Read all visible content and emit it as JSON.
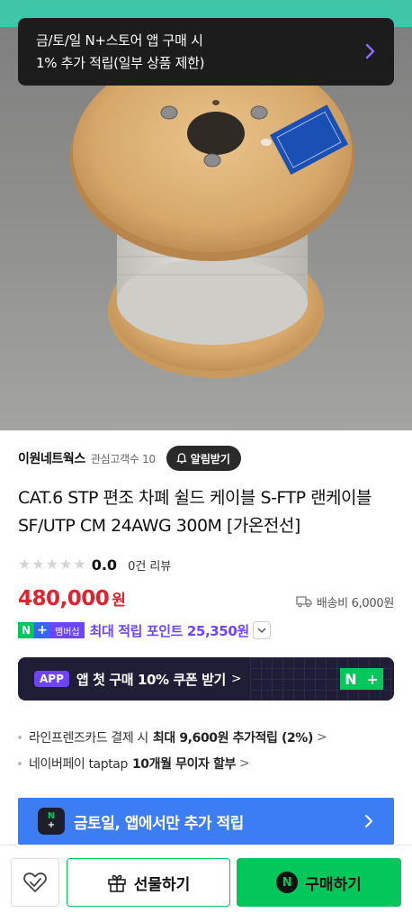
{
  "toast": {
    "line1": "금/토/일 N+스토어 앱 구매 시",
    "line2": "1% 추가 적립(일부 상품 제한)"
  },
  "seller": {
    "name": "이원네트웍스",
    "fans": "관심고객수 10",
    "alarm_label": "알림받기"
  },
  "product": {
    "title": "CAT.6 STP 편조 차폐 쉴드 케이블 S-FTP 랜케이블 SF/UTP CM 24AWG 300M [가온전선]",
    "score": "0.0",
    "reviews": "0건 리뷰",
    "rating_stars": 0
  },
  "price": {
    "amount": "480,000",
    "unit": "원",
    "shipping": "배송비 6,000원"
  },
  "points": {
    "badge_n": "N",
    "badge_plus": "+",
    "badge_label": "멤버십",
    "text": "최대 적립 포인트 25,350원"
  },
  "app_banner": {
    "tag": "APP",
    "text": "앱 첫 구매 10% 쿠폰 받기",
    "chevron": ">",
    "logo_n": "N",
    "logo_plus": "+"
  },
  "benefits": [
    {
      "prefix": "라인프렌즈카드 결제 시",
      "bold": "최대 9,600원 추가적립 (2%)",
      "more": ">"
    },
    {
      "prefix": "네이버페이 taptap",
      "bold": "10개월 무이자 할부",
      "more": ">"
    }
  ],
  "promo": {
    "logo_n": "N",
    "logo_plus": "+",
    "text": "금토일, 앱에서만 추가 적립"
  },
  "bottom_bar": {
    "gift_label": "선물하기",
    "buy_label": "구매하기",
    "buy_logo": "N"
  },
  "colors": {
    "accent_green": "#03c75a",
    "price_red": "#e0232d",
    "membership_purple": "#6e44ff",
    "promo_blue": "#3d7df4"
  }
}
